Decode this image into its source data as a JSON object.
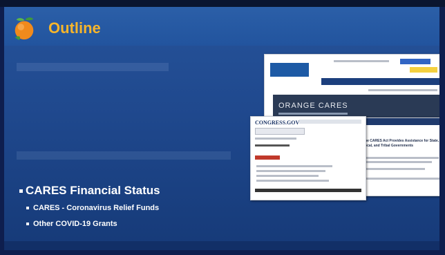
{
  "slide": {
    "title": "Outline",
    "bullets": [
      {
        "text": "CARES Financial Status",
        "subitems": [
          {
            "text": "CARES - Coronavirus Relief Funds"
          },
          {
            "text": "Other COVID-19 Grants"
          }
        ]
      }
    ]
  },
  "screenshots": {
    "orange_county_site": {
      "banner": "ORANGE CARES"
    },
    "congress_site": {
      "logo": "CONGRESS.GOV"
    },
    "treasury_site": {
      "headline": "The CARES Act Provides Assistance for State, Local, and Tribal Governments"
    }
  },
  "colors": {
    "title": "#f6b52b",
    "slide_background": "#1f488d",
    "bullet_text": "#ffffff"
  }
}
